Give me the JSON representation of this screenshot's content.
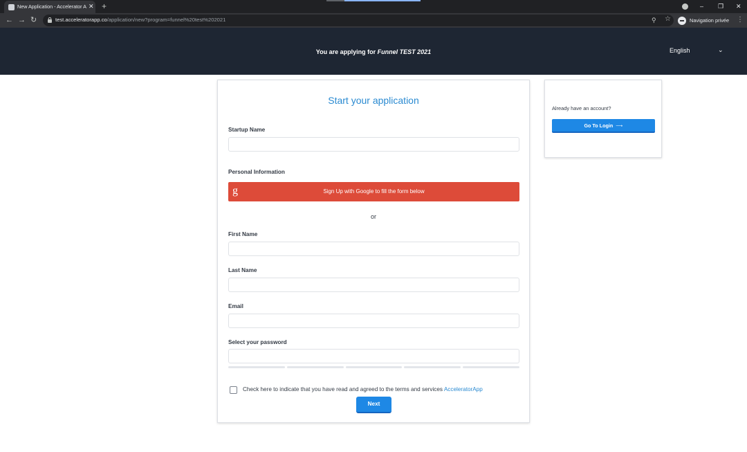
{
  "browser": {
    "tab_title": "New Application - Accelerator Ap",
    "tab_close": "✕",
    "new_tab": "+",
    "url_host": "test.acceleratorapp.co",
    "url_path": "/application/new?program=funnel%20test%202021",
    "private_label": "Navigation privée",
    "icons": [
      "back-icon",
      "forward-icon",
      "reload-icon",
      "lock-icon",
      "key-icon",
      "star-icon",
      "incognito-icon",
      "kebab-icon",
      "minimize-icon",
      "restore-icon",
      "close-icon"
    ]
  },
  "header": {
    "applying_prefix": "You are applying for",
    "program_name": "Funnel TEST 2021",
    "language": "English"
  },
  "form": {
    "title": "Start your application",
    "startup_name_label": "Startup Name",
    "personal_info_label": "Personal Information",
    "google_button": "Sign Up with Google to fill the form below",
    "or": "or",
    "first_name_label": "First Name",
    "last_name_label": "Last Name",
    "email_label": "Email",
    "password_label": "Select your password",
    "terms_text": "Check here to indicate that you have read and agreed to the terms and services",
    "terms_link": "AcceleratorApp",
    "next_button": "Next",
    "password_strength": 0
  },
  "side": {
    "already_text": "Already have an account?",
    "login_button": "Go To Login"
  },
  "colors": {
    "header_bg": "#1e2633",
    "accent": "#1e88e5",
    "title_blue": "#2a8ad1",
    "google_red": "#dd4b39"
  }
}
